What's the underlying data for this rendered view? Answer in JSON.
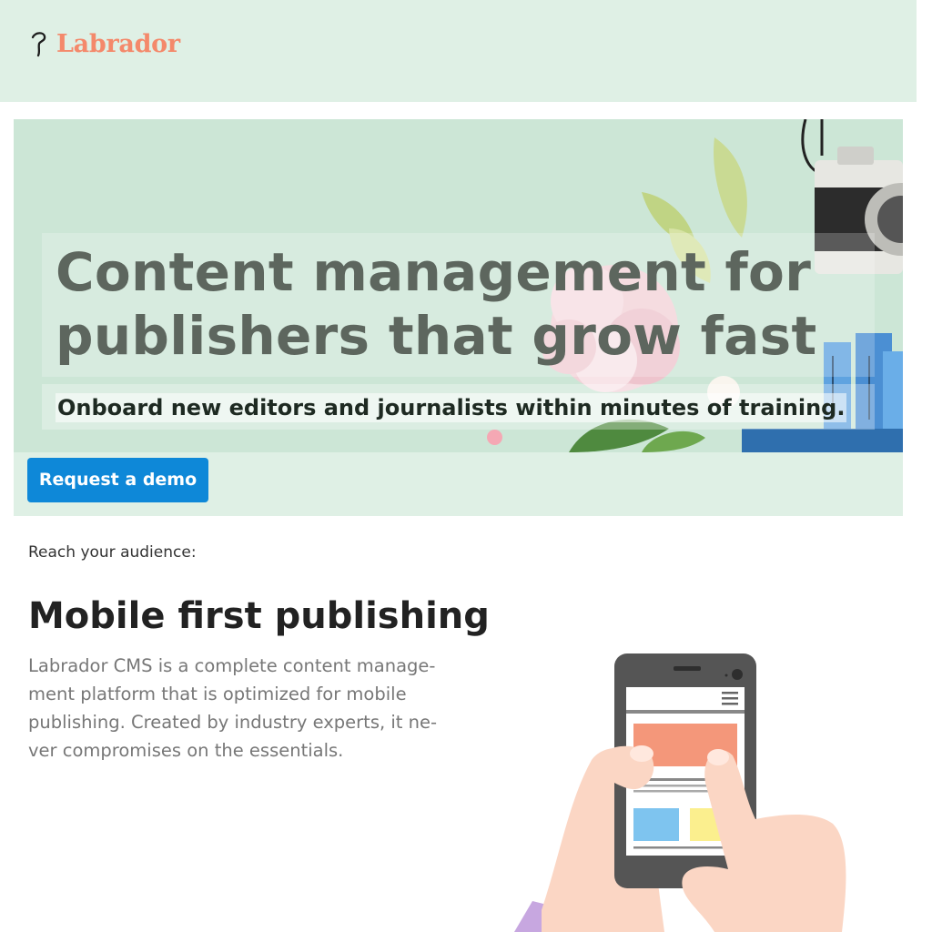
{
  "brand": {
    "name": "Labrador",
    "accent": "#f4896b"
  },
  "hero": {
    "title_line1": "Content management for",
    "title_line2": "publishers that grow fast",
    "subtitle": "Onboard new editors and journalists within minutes of training.",
    "cta_label": "Request a demo",
    "cta_color": "#0e88d8",
    "background": "#cce6d6",
    "carousel_active_color": "#f5a8b4"
  },
  "section": {
    "eyebrow": "Reach your audience:",
    "title": "Mobile first publishing",
    "body_line1": "Labrador CMS is a complete content manage-",
    "body_line2": "ment platform that is optimized for mobile",
    "body_line3": "publishing. Created by industry experts, it ne-",
    "body_line4": "ver compromises on the essentials."
  },
  "icons": [
    "labrador-logo-icon",
    "camera-icon",
    "phone-in-hands-illustration"
  ]
}
